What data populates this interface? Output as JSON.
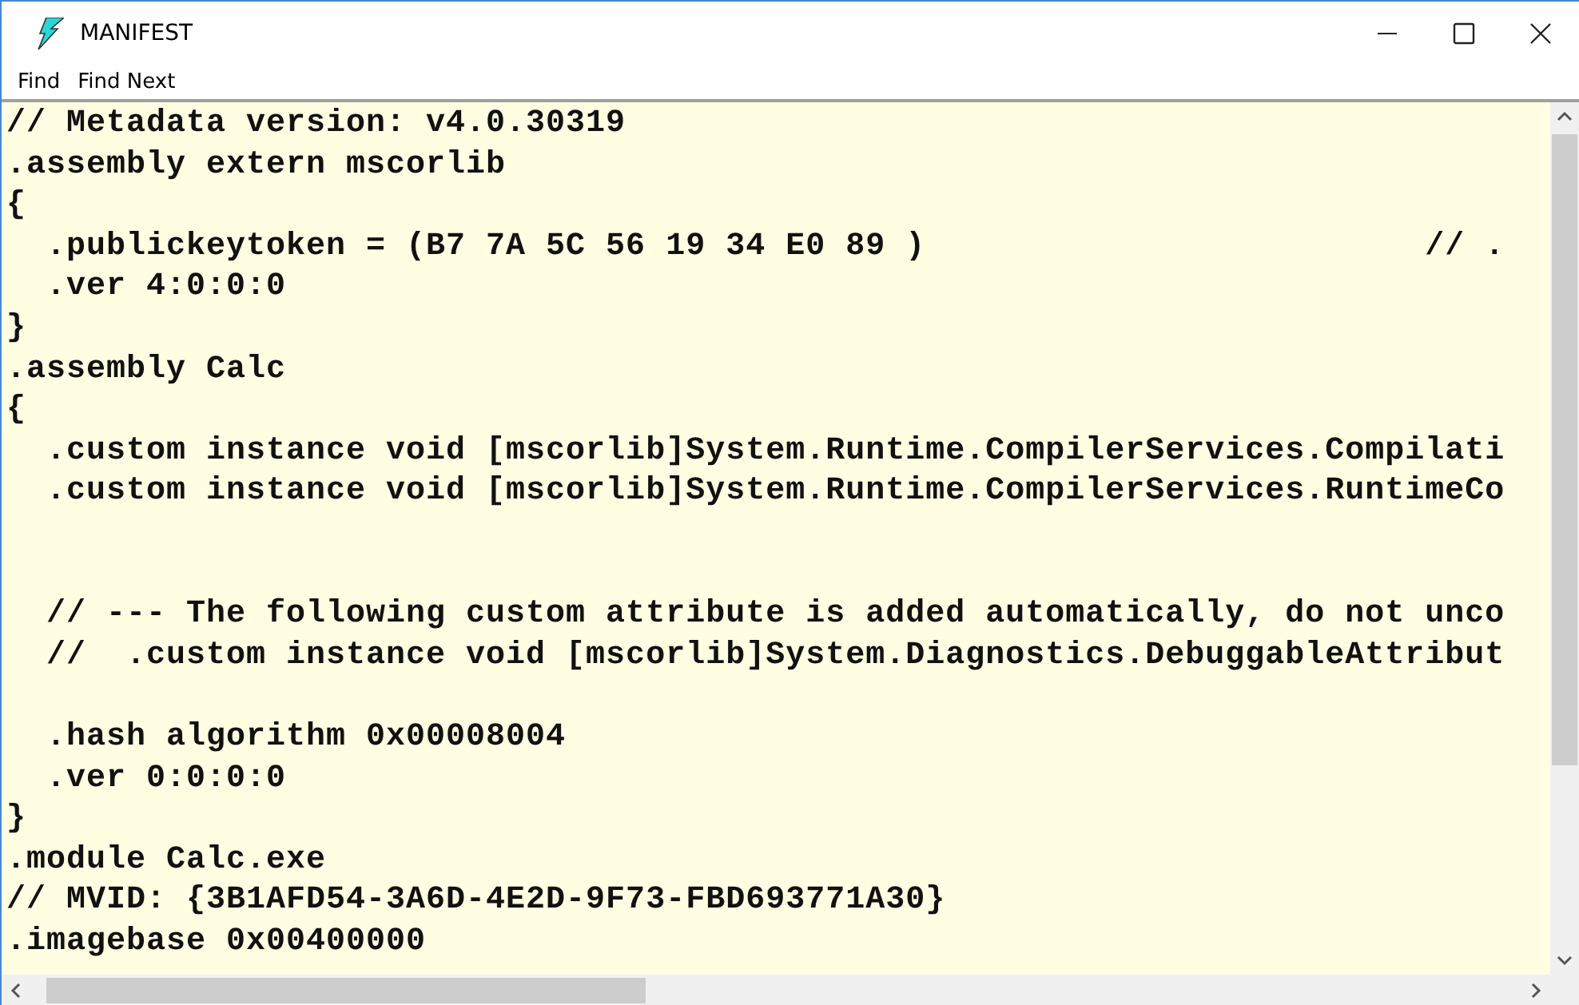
{
  "window": {
    "title": "MANIFEST"
  },
  "menu": [
    "Find",
    "Find Next"
  ],
  "editor": {
    "text": "// Metadata version: v4.0.30319\n.assembly extern mscorlib\n{\n  .publickeytoken = (B7 7A 5C 56 19 34 E0 89 )                         // .\n  .ver 4:0:0:0\n}\n.assembly Calc\n{\n  .custom instance void [mscorlib]System.Runtime.CompilerServices.Compilati\n  .custom instance void [mscorlib]System.Runtime.CompilerServices.RuntimeCo\n\n\n  // --- The following custom attribute is added automatically, do not unco\n  //  .custom instance void [mscorlib]System.Diagnostics.DebuggableAttribut\n\n  .hash algorithm 0x00008004\n  .ver 0:0:0:0\n}\n.module Calc.exe\n// MVID: {3B1AFD54-3A6D-4E2D-9F73-FBD693771A30}\n.imagebase 0x00400000"
  }
}
